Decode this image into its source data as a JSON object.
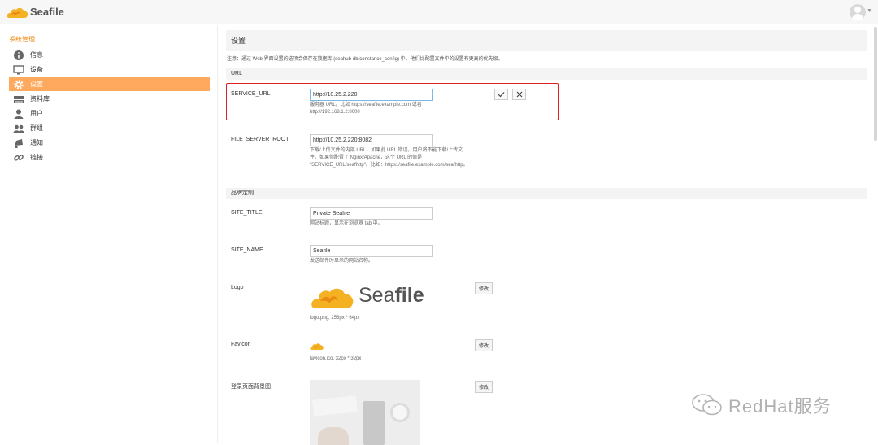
{
  "app": {
    "brand": "Seafile"
  },
  "sidebar": {
    "title": "系统管理",
    "items": [
      {
        "label": "信息",
        "icon": "info-icon"
      },
      {
        "label": "设备",
        "icon": "monitor-icon"
      },
      {
        "label": "设置",
        "icon": "gear-icon",
        "active": true
      },
      {
        "label": "资料库",
        "icon": "library-icon"
      },
      {
        "label": "用户",
        "icon": "user-icon"
      },
      {
        "label": "群组",
        "icon": "group-icon"
      },
      {
        "label": "通知",
        "icon": "notification-icon"
      },
      {
        "label": "链接",
        "icon": "link-icon"
      }
    ]
  },
  "main": {
    "title": "设置",
    "note": "注意：通过 Web 界面设置的选项会保存在数据库 (seahub-db/constance_config) 中。他们比配置文件中的设置有更高的优先级。",
    "sections": {
      "url": "URL",
      "branding": "品牌定制"
    },
    "service_url": {
      "label": "SERVICE_URL",
      "value": "http://10.25.2.220",
      "help_1": "服务器 URL。比如 https://seafile.example.com 或者",
      "help_2": "http://192.168.1.2:8000"
    },
    "file_server_root": {
      "label": "FILE_SERVER_ROOT",
      "value": "http://10.25.2.220:8082",
      "help_1": "下载/上传文件的内部 URL。如果此 URL 错误，用户将不能下载/上传文",
      "help_2": "件。如果你配置了 Nginx/Apache，这个 URL 的值是",
      "help_3": "\"SERVICE_URL/seafhttp\"。比如：https://seafile.example.com/seafhttp。"
    },
    "site_title": {
      "label": "SITE_TITLE",
      "value": "Private Seafile",
      "help": "网站标题，显示在浏览器 tab 中。"
    },
    "site_name": {
      "label": "SITE_NAME",
      "value": "Seafile",
      "help": "发送邮件时显示的网站名称。"
    },
    "logo": {
      "label": "Logo",
      "caption": "logo.png, 256px * 64px",
      "modify": "修改"
    },
    "favicon": {
      "label": "Favicon",
      "caption": "favicon.ico, 32px * 32px",
      "modify": "修改"
    },
    "login_bg": {
      "label": "登录页面背景图",
      "modify": "修改"
    }
  },
  "watermark": {
    "text": "RedHat服务"
  },
  "colors": {
    "accent": "#fea95e",
    "brand_orange": "#eb8205",
    "highlight_box": "#e02020"
  }
}
